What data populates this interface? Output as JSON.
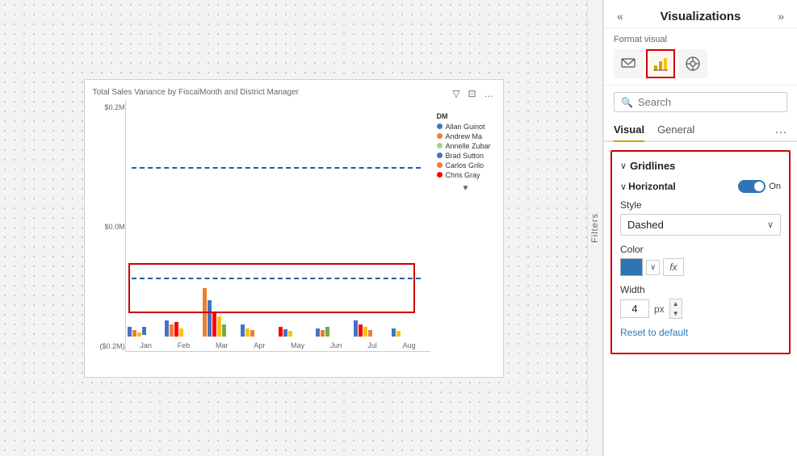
{
  "panel": {
    "title": "Visualizations",
    "collapse_left": "«",
    "collapse_right": "»",
    "back_arrow": "◁",
    "format_label": "Format visual",
    "search_placeholder": "Search",
    "tabs": [
      "Visual",
      "General"
    ],
    "tab_active": "Visual",
    "tab_more": "…",
    "sections": {
      "gridlines": {
        "label": "Gridlines",
        "subsections": {
          "horizontal": {
            "label": "Horizontal",
            "toggle": "On",
            "style_label": "Style",
            "style_value": "Dashed",
            "color_label": "Color",
            "width_label": "Width",
            "width_value": "4",
            "width_unit": "px",
            "reset_label": "Reset to default",
            "fx_label": "fx"
          }
        }
      }
    }
  },
  "chart": {
    "title": "Total Sales Variance by FiscalMonth and District Manager",
    "y_labels": [
      "$0.2M",
      "$0.0M",
      "($0.2M)"
    ],
    "x_labels": [
      "Jan",
      "Feb",
      "Mar",
      "Apr",
      "May",
      "Jun",
      "Jul",
      "Aug"
    ],
    "legend_title": "DM",
    "legend_items": [
      {
        "name": "Allan Guinot",
        "color": "#4472C4"
      },
      {
        "name": "Andrew Ma",
        "color": "#ED7D31"
      },
      {
        "name": "Annelle Zubar",
        "color": "#A9D18E"
      },
      {
        "name": "Brad Sutton",
        "color": "#4472C4"
      },
      {
        "name": "Carlos Grilo",
        "color": "#ED7D31"
      },
      {
        "name": "Chris Gray",
        "color": "#FF0000"
      }
    ],
    "dashed_line_top": "28%",
    "dashed_line_bottom": "72%"
  },
  "filters_label": "Filters"
}
